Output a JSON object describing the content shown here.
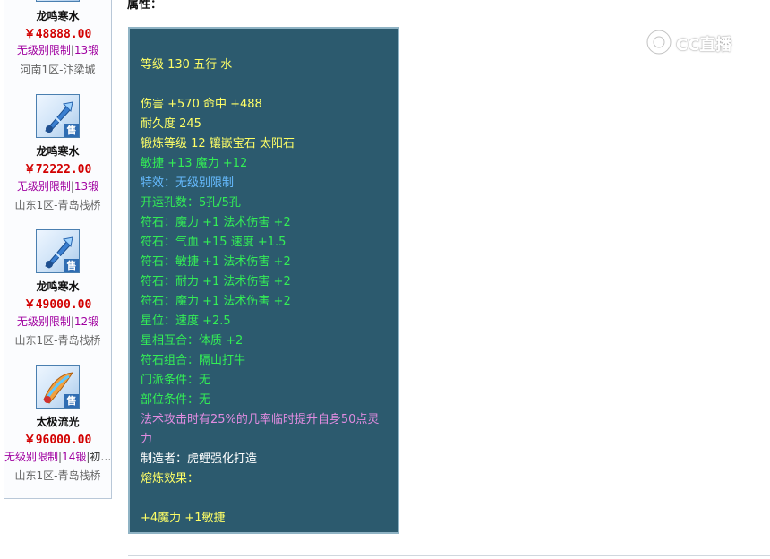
{
  "sidebar": {
    "items": [
      {
        "name": "龙鸣寒水",
        "price": "￥48888.00",
        "limit": "无级别限制",
        "forge": "13锻",
        "server": "河南1区-汴梁城",
        "sell_badge": "售"
      },
      {
        "name": "龙鸣寒水",
        "price": "￥72222.00",
        "limit": "无级别限制",
        "forge": "13锻",
        "server": "山东1区-青岛栈桥",
        "sell_badge": "售"
      },
      {
        "name": "龙鸣寒水",
        "price": "￥49000.00",
        "limit": "无级别限制",
        "forge": "12锻",
        "server": "山东1区-青岛栈桥",
        "sell_badge": "售"
      },
      {
        "name": "太极流光",
        "price": "￥96000.00",
        "limit": "无级别限制",
        "forge": "14锻",
        "extra": "初…",
        "server": "山东1区-青岛栈桥",
        "sell_badge": "售"
      }
    ]
  },
  "attr_label": "属性：",
  "panel": {
    "lines": [
      {
        "text": "等级 130 五行 水",
        "color": "#ffff66"
      },
      {
        "text": "伤害 +570 命中 +488",
        "color": "#ffff66"
      },
      {
        "text": "耐久度 245",
        "color": "#ffff66"
      },
      {
        "text": "锻炼等级 12 镶嵌宝石 太阳石",
        "color": "#ffff66"
      },
      {
        "text": "敏捷 +13 魔力 +12",
        "color": "#33ee55"
      },
      {
        "text": "特效：无级别限制",
        "color": "#66bbff"
      },
      {
        "text": "开运孔数：5孔/5孔",
        "color": "#33ee55"
      },
      {
        "text": "符石：魔力 +1 法术伤害 +2",
        "color": "#33ee55"
      },
      {
        "text": "符石：气血 +15 速度 +1.5",
        "color": "#33ee55"
      },
      {
        "text": "符石：敏捷 +1 法术伤害 +2",
        "color": "#33ee55"
      },
      {
        "text": "符石：耐力 +1 法术伤害 +2",
        "color": "#33ee55"
      },
      {
        "text": "符石：魔力 +1 法术伤害 +2",
        "color": "#33ee55"
      },
      {
        "text": "星位：速度 +2.5",
        "color": "#33ee55"
      },
      {
        "text": "星相互合：体质 +2",
        "color": "#33ee55"
      },
      {
        "text": "符石组合：隔山打牛",
        "color": "#33ee55"
      },
      {
        "text": "门派条件：无",
        "color": "#33ee55"
      },
      {
        "text": "部位条件：无",
        "color": "#33ee55"
      },
      {
        "text": "法术攻击时有25%的几率临时提升自身50点灵",
        "color": "#e08ce0"
      },
      {
        "text": "力",
        "color": "#e08ce0"
      },
      {
        "text": "制造者：虎鲤强化打造",
        "color": "#ffffff"
      },
      {
        "text": "熔炼效果：",
        "color": "#ffff66"
      },
      {
        "text": "+4魔力 +1敏捷",
        "color": "#ffff66"
      }
    ]
  },
  "watermark": {
    "text": "CC直播"
  },
  "colors": {
    "panel_bg": "#2c5a6e",
    "price_red": "#d20000",
    "limit_purple": "#a000a0"
  }
}
